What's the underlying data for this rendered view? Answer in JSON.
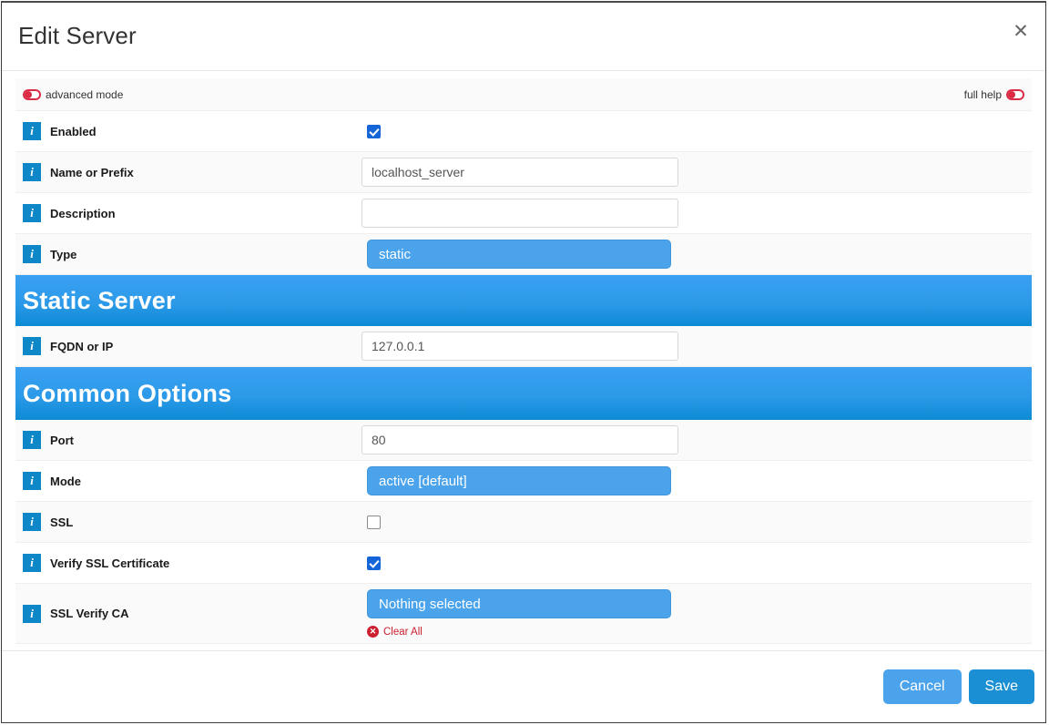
{
  "dialog": {
    "title": "Edit Server",
    "close_icon": "close-icon"
  },
  "mode_bar": {
    "advanced_mode_label": "advanced mode",
    "advanced_mode_state": "off",
    "full_help_label": "full help",
    "full_help_state": "off",
    "toggle_color": "#dc2b45"
  },
  "form": {
    "rows": [
      {
        "label": "Enabled",
        "type": "checkbox",
        "checked": true,
        "name": "enabled"
      },
      {
        "label": "Name or Prefix",
        "type": "text",
        "value": "localhost_server",
        "placeholder": "",
        "name": "name-or-prefix"
      },
      {
        "label": "Description",
        "type": "text",
        "value": "",
        "placeholder": "",
        "name": "description"
      },
      {
        "label": "Type",
        "type": "select",
        "value": "static",
        "name": "type"
      }
    ]
  },
  "static_server": {
    "section_title": "Static Server",
    "rows": [
      {
        "label": "FQDN or IP",
        "type": "text",
        "value": "127.0.0.1",
        "placeholder": "",
        "name": "fqdn-or-ip"
      }
    ]
  },
  "common_options": {
    "section_title": "Common Options",
    "rows": [
      {
        "label": "Port",
        "type": "text",
        "value": "80",
        "placeholder": "",
        "name": "port"
      },
      {
        "label": "Mode",
        "type": "select",
        "value": "active [default]",
        "name": "mode"
      },
      {
        "label": "SSL",
        "type": "checkbox",
        "checked": false,
        "name": "ssl"
      },
      {
        "label": "Verify SSL Certificate",
        "type": "checkbox",
        "checked": true,
        "name": "verify-ssl-certificate"
      },
      {
        "label": "SSL Verify CA",
        "type": "select-multi",
        "value": "Nothing selected",
        "clear_label": "Clear All",
        "name": "ssl-verify-ca"
      }
    ]
  },
  "footer": {
    "cancel_label": "Cancel",
    "save_label": "Save"
  },
  "colors": {
    "accent_blue": "#0e87c8",
    "select_blue": "#4aa3eb",
    "save_blue": "#1a8fd4",
    "checkbox_blue": "#1565d8",
    "danger_red": "#cc2030",
    "toggle_red": "#dc2b45"
  }
}
